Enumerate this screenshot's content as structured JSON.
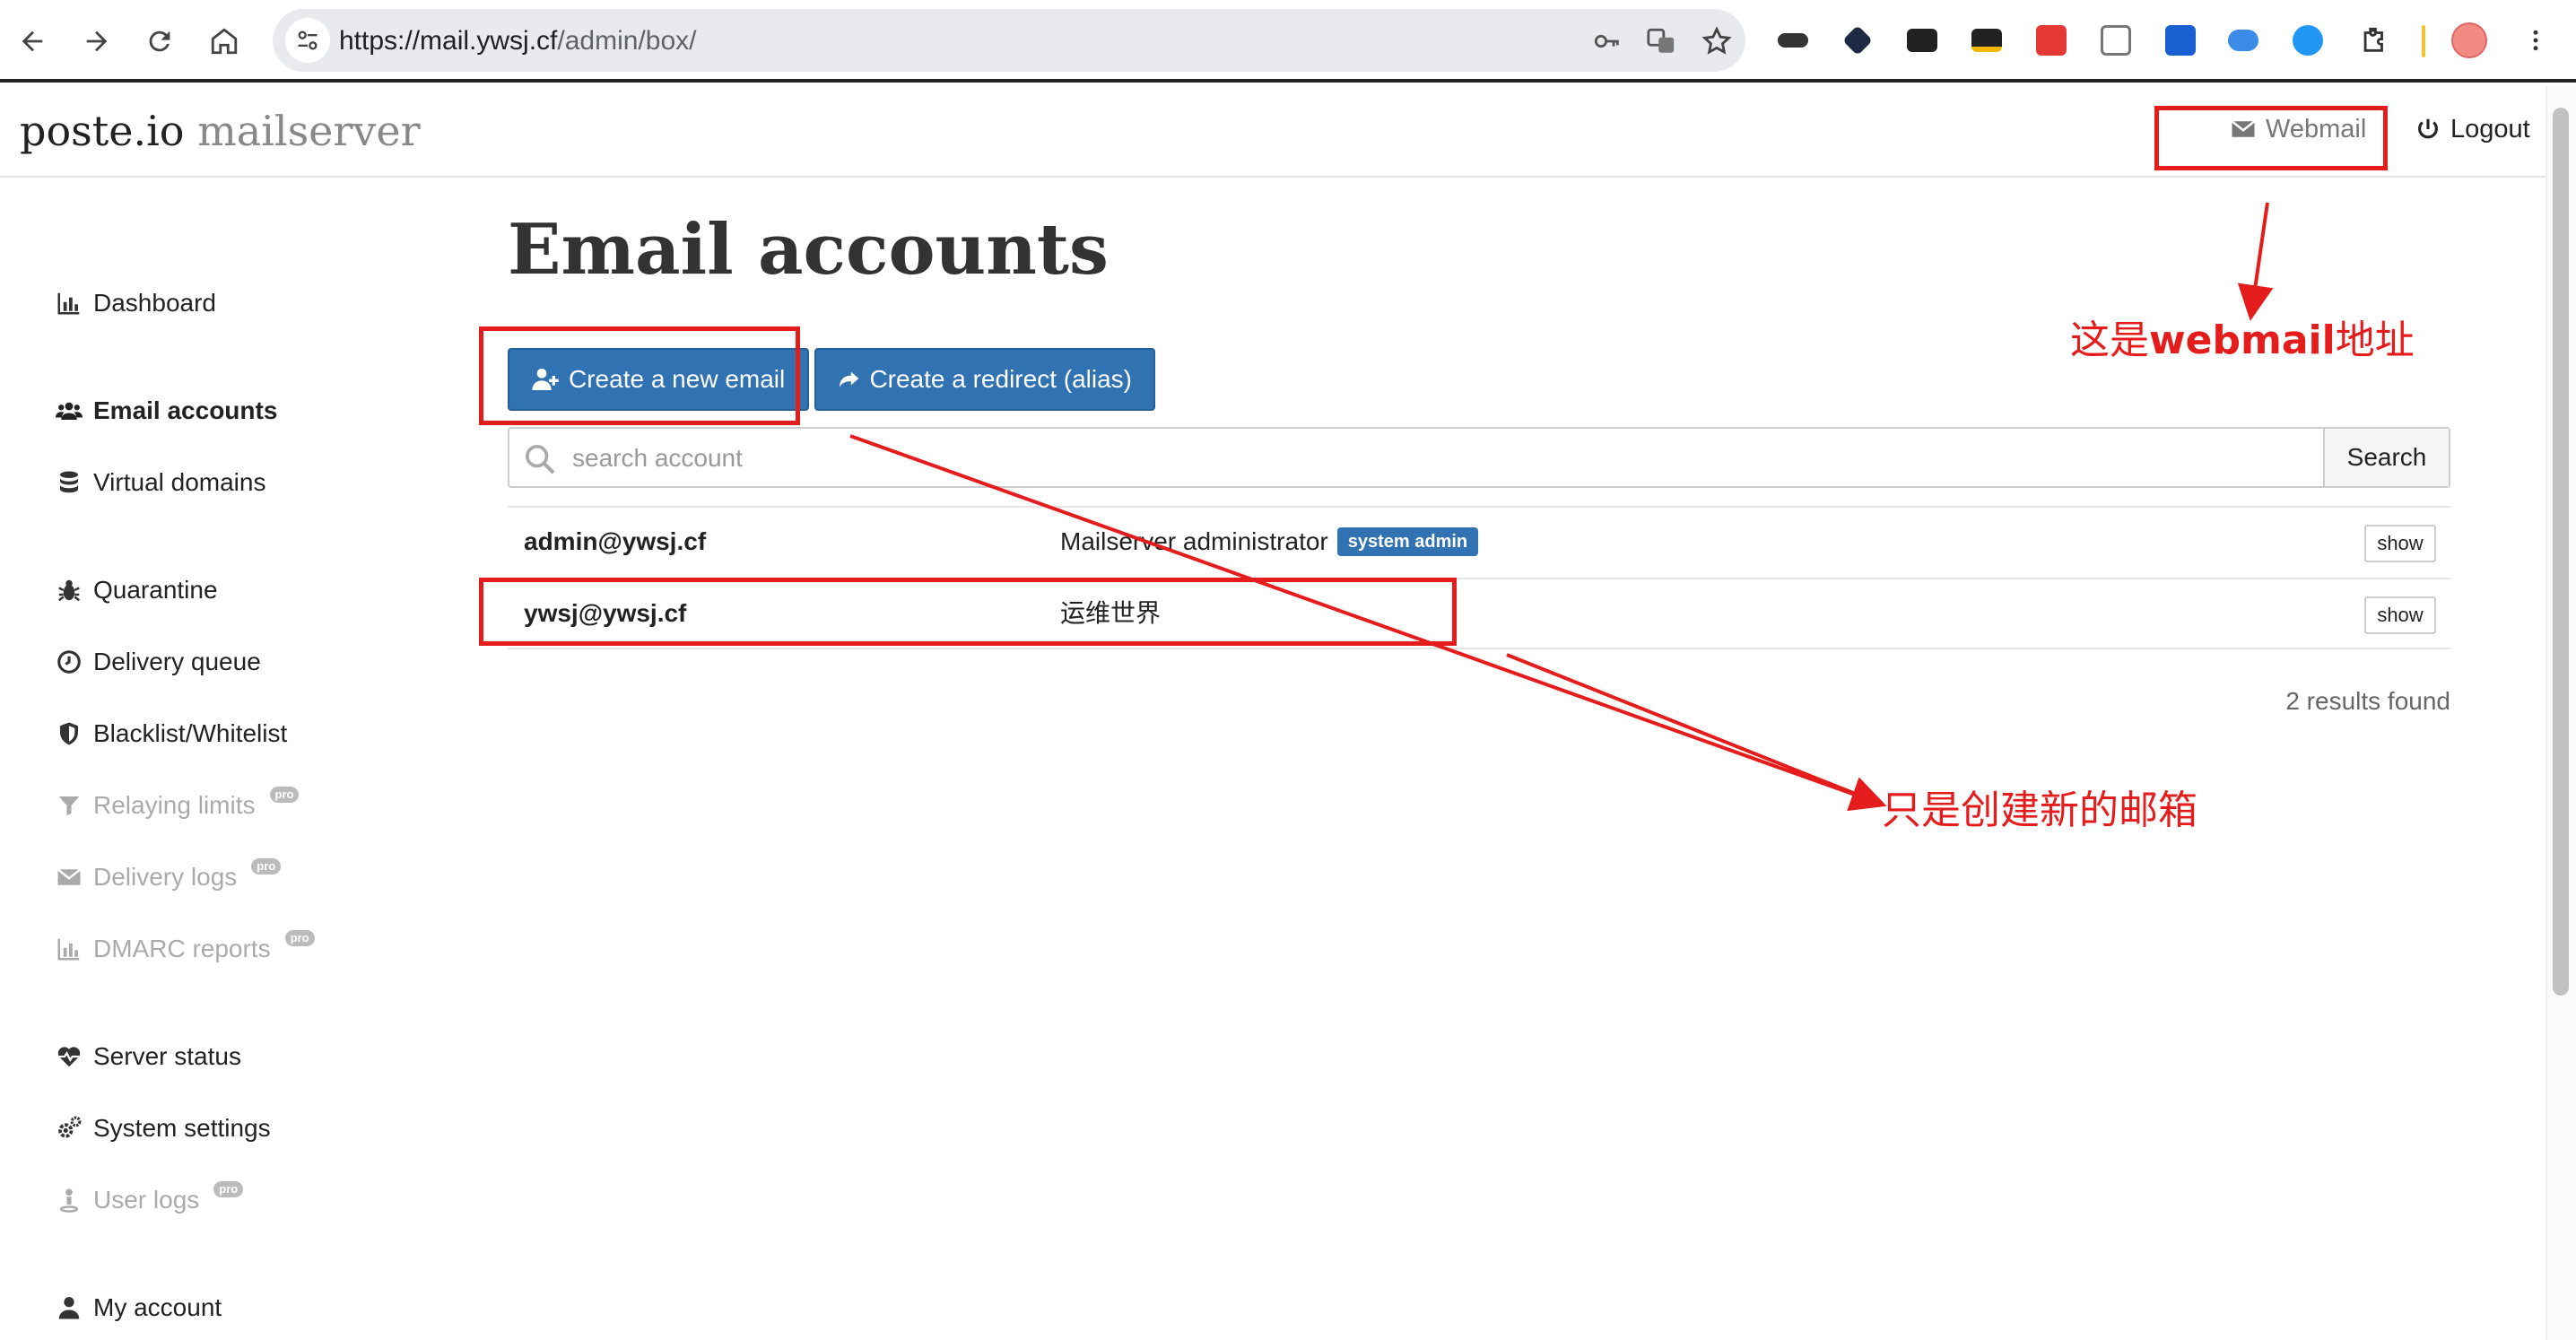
{
  "browser": {
    "url_host": "https://mail.ywsj.cf",
    "url_path": "/admin/box/"
  },
  "header": {
    "brand_main": "poste.io",
    "brand_sub": "mailserver",
    "webmail_label": "Webmail",
    "logout_label": "Logout"
  },
  "sidebar": {
    "items": [
      {
        "label": "Dashboard",
        "icon": "bar-chart-icon"
      },
      {
        "label": "Email accounts",
        "icon": "users-icon",
        "active": true
      },
      {
        "label": "Virtual domains",
        "icon": "database-icon"
      },
      {
        "label": "Quarantine",
        "icon": "bug-icon"
      },
      {
        "label": "Delivery queue",
        "icon": "clock-icon"
      },
      {
        "label": "Blacklist/Whitelist",
        "icon": "shield-icon"
      },
      {
        "label": "Relaying limits",
        "icon": "filter-icon",
        "disabled": true,
        "badge": "pro"
      },
      {
        "label": "Delivery logs",
        "icon": "envelope-icon",
        "disabled": true,
        "badge": "pro"
      },
      {
        "label": "DMARC reports",
        "icon": "bar-chart-icon",
        "disabled": true,
        "badge": "pro"
      },
      {
        "label": "Server status",
        "icon": "heartbeat-icon"
      },
      {
        "label": "System settings",
        "icon": "cogs-icon"
      },
      {
        "label": "User logs",
        "icon": "user-pin-icon",
        "disabled": true,
        "badge": "pro"
      },
      {
        "label": "My account",
        "icon": "user-icon"
      }
    ]
  },
  "main": {
    "title": "Email accounts",
    "create_email_label": "Create a new email",
    "create_redirect_label": "Create a redirect (alias)",
    "search_placeholder": "search account",
    "search_button": "Search",
    "accounts": [
      {
        "email": "admin@ywsj.cf",
        "name": "Mailserver administrator",
        "badge": "system admin",
        "action": "show"
      },
      {
        "email": "ywsj@ywsj.cf",
        "name": "运维世界",
        "badge": "",
        "action": "show"
      }
    ],
    "results_text": "2 results found"
  },
  "annotations": {
    "webmail_note_prefix": "这是",
    "webmail_note_bold": "webmail",
    "webmail_note_suffix": "地址",
    "create_note": "只是创建新的邮箱",
    "color": "#e51c1c"
  },
  "colors": {
    "primary_button": "#3072b2",
    "annotation_red": "#e51c1c"
  }
}
